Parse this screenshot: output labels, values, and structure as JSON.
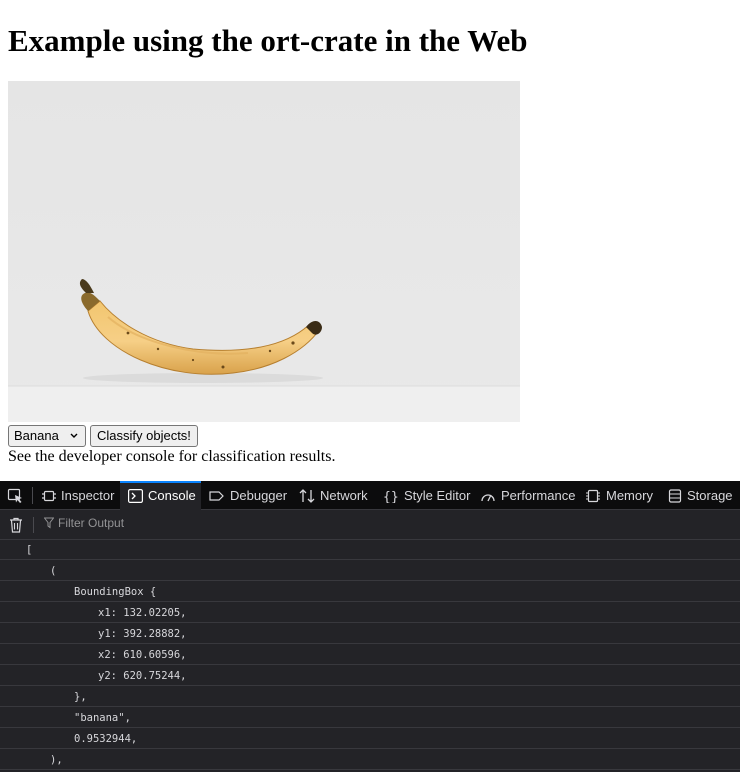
{
  "page": {
    "title": "Example using the ort-crate in the Web",
    "image_alt": "banana photo",
    "select_value": "Banana",
    "classify_button": "Classify objects!",
    "hint": "See the developer console for classification results."
  },
  "devtools": {
    "tabs": [
      {
        "label": "Inspector",
        "icon": "inspector-icon"
      },
      {
        "label": "Console",
        "icon": "console-icon",
        "active": true
      },
      {
        "label": "Debugger",
        "icon": "debugger-icon"
      },
      {
        "label": "Network",
        "icon": "network-icon"
      },
      {
        "label": "Style Editor",
        "icon": "style-editor-icon"
      },
      {
        "label": "Performance",
        "icon": "performance-icon"
      },
      {
        "label": "Memory",
        "icon": "memory-icon"
      },
      {
        "label": "Storage",
        "icon": "storage-icon"
      }
    ],
    "filter_placeholder": "Filter Output",
    "console_lines": [
      "[",
      "(",
      "BoundingBox {",
      "x1: 132.02205,",
      "y1: 392.28882,",
      "x2: 610.60596,",
      "y2: 620.75244,",
      "},",
      "\"banana\",",
      "0.9532944,",
      "),"
    ],
    "colors": {
      "background": "#232327",
      "toolbar": "#0c0c0d",
      "accent": "#0a84ff",
      "text": "#d7d7db"
    }
  }
}
